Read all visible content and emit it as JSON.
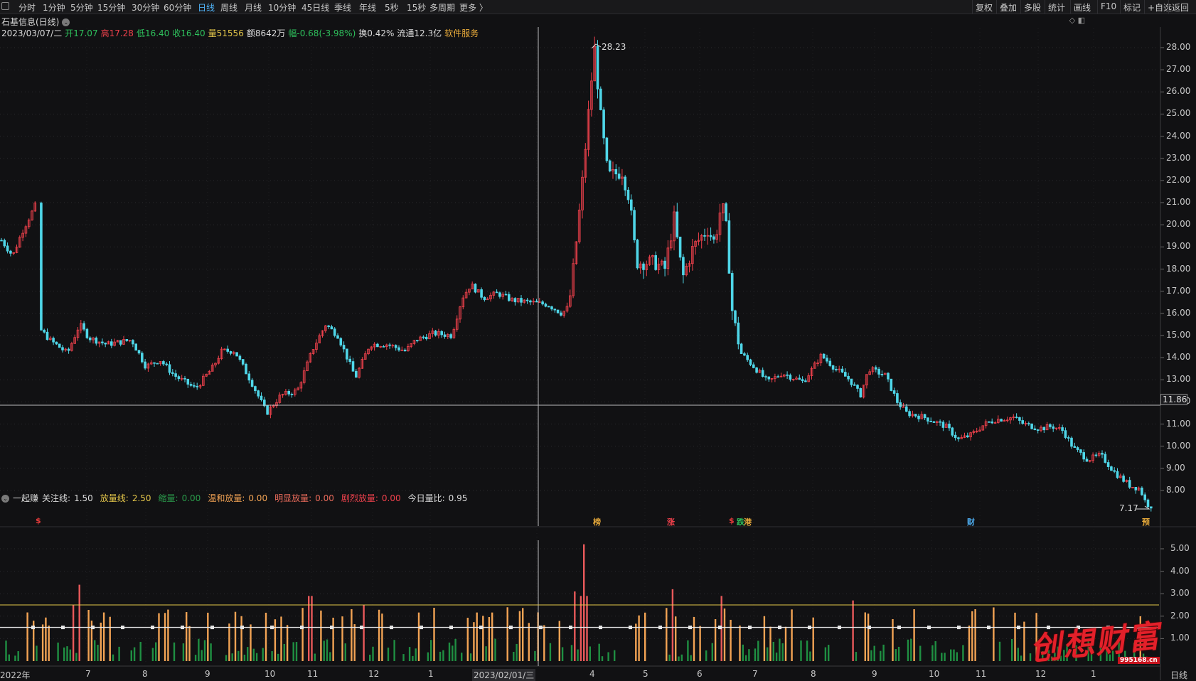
{
  "toolbar": {
    "left": [
      "分时",
      "1分钟",
      "5分钟",
      "15分钟",
      "30分钟",
      "60分钟",
      "日线",
      "周线",
      "月线",
      "10分钟",
      "45日线",
      "季线",
      "年线",
      "5秒",
      "15秒",
      "多周期",
      "更多 〉"
    ],
    "active_index": 6,
    "right": [
      "复权",
      "叠加",
      "多股",
      "统计",
      "画线",
      "F10",
      "标记",
      "+自选",
      "返回"
    ]
  },
  "stock": {
    "title": "石基信息(日线)",
    "date": "2023/03/07/二",
    "open": "开17.07",
    "high": "高17.28",
    "low": "低16.40",
    "close": "收16.40",
    "volume": "量51556",
    "amount": "额8642万",
    "change": "幅-0.68(-3.98%)",
    "turnover": "换0.42%",
    "float": "流通12.3亿",
    "sector": "软件服务"
  },
  "price_axis": {
    "ticks": [
      "28.00",
      "27.00",
      "26.00",
      "25.00",
      "24.00",
      "23.00",
      "22.00",
      "21.00",
      "20.00",
      "19.00",
      "18.00",
      "17.00",
      "16.00",
      "15.00",
      "14.00",
      "13.00",
      "12.00",
      "11.00",
      "10.00",
      "9.00",
      "8.00"
    ],
    "crosshair_value": "11.86",
    "max_label": "28.23",
    "min_label": "7.17"
  },
  "indicator": {
    "name": "一起赚",
    "attention": {
      "label": "关注线:",
      "value": "1.50"
    },
    "enlarge": {
      "label": "放量线:",
      "value": "2.50"
    },
    "shrink": {
      "label": "缩量:",
      "value": "0.00"
    },
    "mild": {
      "label": "温和放量:",
      "value": "0.00"
    },
    "obvious": {
      "label": "明显放量:",
      "value": "0.00"
    },
    "strong": {
      "label": "剧烈放量:",
      "value": "0.00"
    },
    "ratio": {
      "label": "今日量比:",
      "value": "0.95"
    },
    "axis_ticks": [
      "5.00",
      "4.00",
      "3.00",
      "2.00",
      "1.00"
    ]
  },
  "markers": [
    {
      "text": "$",
      "color": "#e53b3b"
    },
    {
      "text": "榜",
      "color": "#e6a93a"
    },
    {
      "text": "涨",
      "color": "#f0414c"
    },
    {
      "text": "$",
      "color": "#e53b3b"
    },
    {
      "text": "跌",
      "color": "#2ec05c"
    },
    {
      "text": "港",
      "color": "#e6a93a"
    },
    {
      "text": "财",
      "color": "#4fb1f5"
    },
    {
      "text": "预",
      "color": "#e6a93a"
    }
  ],
  "x_axis": {
    "labels": [
      "2022年",
      "7",
      "8",
      "9",
      "10",
      "11",
      "12",
      "1",
      "2023/02/01/三",
      "4",
      "5",
      "6",
      "7",
      "8",
      "9",
      "10",
      "11",
      "12",
      "1"
    ],
    "period_label": "日线"
  },
  "watermark": {
    "text": "创想财富",
    "url": "995168.cn"
  },
  "colors": {
    "up": "#f0414c",
    "down": "#4fd6e8",
    "vol_up": "#f2a354",
    "vol_down": "#1f8f42",
    "accent": "#4fb1f5"
  }
}
